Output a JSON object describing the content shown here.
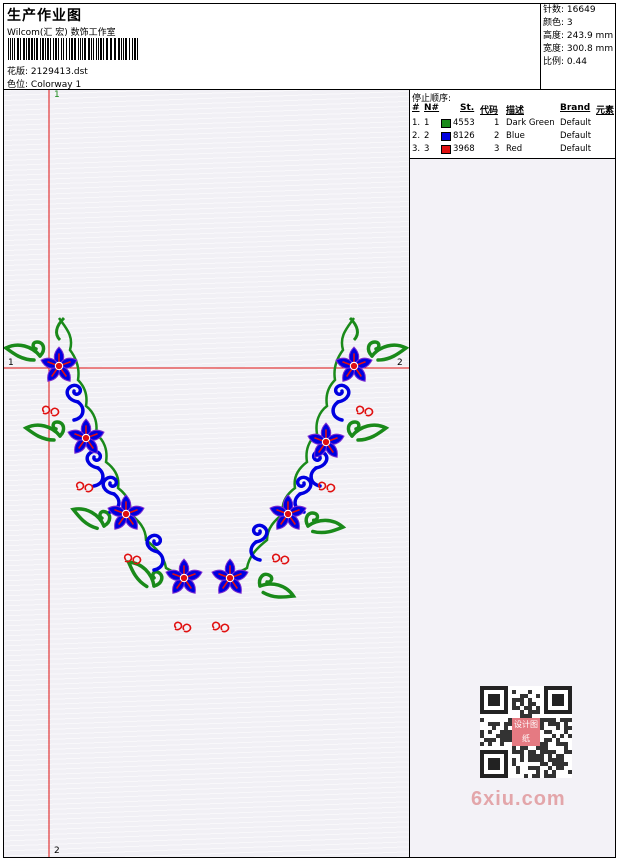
{
  "header": {
    "title": "生产作业图",
    "company": "Wilcom(汇 宏) 数饰工作室",
    "design_label": "花版:",
    "design_file": "2129413.dst",
    "colorway_label": "色位:",
    "colorway": "Colorway 1"
  },
  "info": [
    {
      "label": "针数:",
      "value": "16649"
    },
    {
      "label": "颜色:",
      "value": "3"
    },
    {
      "label": "高度:",
      "value": "243.9 mm"
    },
    {
      "label": "宽度:",
      "value": "300.8 mm"
    },
    {
      "label": "比例:",
      "value": "0.44"
    }
  ],
  "stop_sequence": {
    "title": "停止顺序:",
    "headers": [
      "#",
      "N#",
      "St.",
      "代码",
      "描述",
      "Brand",
      "元素"
    ],
    "rows": [
      {
        "idx": "1.",
        "n": "1",
        "color": "#1a8a1a",
        "stitches": "4553",
        "code": "1",
        "desc": "Dark Green",
        "brand": "Default"
      },
      {
        "idx": "2.",
        "n": "2",
        "color": "#0000e0",
        "stitches": "8126",
        "code": "2",
        "desc": "Blue",
        "brand": "Default"
      },
      {
        "idx": "3.",
        "n": "3",
        "color": "#e01010",
        "stitches": "3968",
        "code": "3",
        "desc": "Red",
        "brand": "Default"
      }
    ]
  },
  "axis": {
    "v_top": "1",
    "v_bottom": "2",
    "h_left": "1",
    "h_right": "2"
  },
  "colors": {
    "axis": "#e01010",
    "green": "#1a8a1a",
    "blue": "#0000e0",
    "red": "#e01010",
    "purple": "#7a2bd0"
  },
  "watermark": {
    "text": "6xiu.com",
    "stamp": "设计图纸"
  }
}
